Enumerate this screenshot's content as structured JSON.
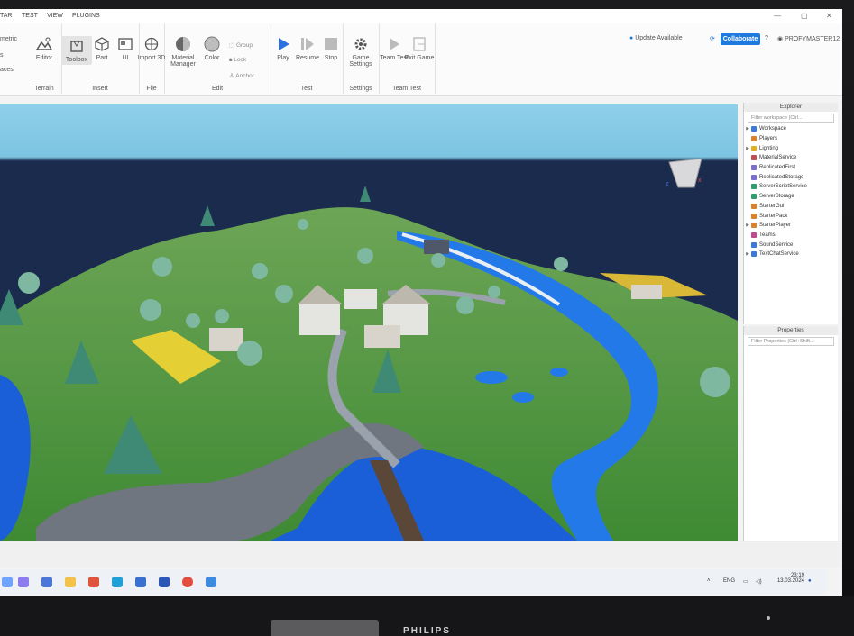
{
  "titlebar": {
    "menu_tabs": [
      "TAR",
      "TEST",
      "VIEW",
      "PLUGINS"
    ]
  },
  "ribbon": {
    "left_labels": [
      "metric",
      "s",
      "aces"
    ],
    "groups": [
      {
        "title": "Terrain",
        "tools": [
          {
            "label": "Editor",
            "icon": "terrain-editor-icon"
          }
        ]
      },
      {
        "title": "Insert",
        "tools": [
          {
            "label": "Toolbox",
            "icon": "toolbox-icon"
          },
          {
            "label": "Part",
            "icon": "part-icon"
          },
          {
            "label": "UI",
            "icon": "ui-icon"
          }
        ]
      },
      {
        "title": "File",
        "tools": [
          {
            "label": "Import 3D",
            "icon": "import-3d-icon"
          }
        ]
      },
      {
        "title": "Edit",
        "tools": [
          {
            "label": "Material Manager",
            "icon": "material-manager-icon"
          },
          {
            "label": "Color",
            "icon": "color-icon"
          }
        ],
        "small": [
          "Group",
          "Lock",
          "Anchor"
        ]
      },
      {
        "title": "Test",
        "tools": [
          {
            "label": "Play",
            "icon": "play-icon"
          },
          {
            "label": "Resume",
            "icon": "resume-icon"
          },
          {
            "label": "Stop",
            "icon": "stop-icon"
          }
        ]
      },
      {
        "title": "Settings",
        "tools": [
          {
            "label": "Game Settings",
            "icon": "gear-icon"
          }
        ]
      },
      {
        "title": "Team Test",
        "tools": [
          {
            "label": "Team Test",
            "icon": "team-test-icon"
          },
          {
            "label": "Exit Game",
            "icon": "exit-game-icon"
          }
        ]
      }
    ],
    "update_text": "Update Available",
    "collaborate_label": "Collaborate",
    "username": "PROFYMASTER12"
  },
  "explorer": {
    "title": "Explorer",
    "filter_placeholder": "Filter workspace (Ctrl...",
    "items": [
      {
        "label": "Workspace",
        "expandable": true,
        "color": "#3b7ad8"
      },
      {
        "label": "Players",
        "expandable": false,
        "color": "#d9822b"
      },
      {
        "label": "Lighting",
        "expandable": true,
        "color": "#e0b020"
      },
      {
        "label": "MaterialService",
        "expandable": false,
        "color": "#c0504d"
      },
      {
        "label": "ReplicatedFirst",
        "expandable": false,
        "color": "#7a6fd0"
      },
      {
        "label": "ReplicatedStorage",
        "expandable": false,
        "color": "#7a6fd0"
      },
      {
        "label": "ServerScriptService",
        "expandable": false,
        "color": "#2f9e6e"
      },
      {
        "label": "ServerStorage",
        "expandable": false,
        "color": "#2f9e6e"
      },
      {
        "label": "StarterGui",
        "expandable": false,
        "color": "#d9822b"
      },
      {
        "label": "StarterPack",
        "expandable": false,
        "color": "#d9822b"
      },
      {
        "label": "StarterPlayer",
        "expandable": true,
        "color": "#d9822b"
      },
      {
        "label": "Teams",
        "expandable": false,
        "color": "#c04a8f"
      },
      {
        "label": "SoundService",
        "expandable": false,
        "color": "#3b7ad8"
      },
      {
        "label": "TextChatService",
        "expandable": true,
        "color": "#3b7ad8"
      }
    ]
  },
  "properties": {
    "title": "Properties",
    "filter_placeholder": "Filter Properties (Ctrl+Shift..."
  },
  "taskbar": {
    "lang": "ENG",
    "time": "23:19",
    "date": "13.03.2024"
  },
  "monitor": {
    "brand": "PHILIPS"
  }
}
